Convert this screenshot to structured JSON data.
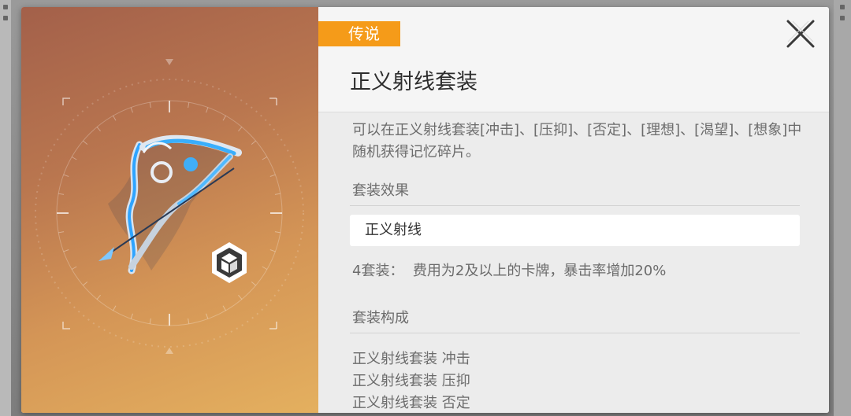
{
  "dialog": {
    "rarity": "传说",
    "title": "正义射线套装",
    "description": "可以在正义射线套装[冲击]、[压抑]、[否定]、[理想]、[渴望]、[想象]中随机获得记忆碎片。",
    "close_icon": "close-x-icon",
    "item_icon": "bow-weapon-image",
    "type_badge_icon": "cube-icon"
  },
  "set_effect": {
    "heading": "套装效果",
    "name": "正义射线",
    "bonus_label": "4套装：",
    "bonus_text": "费用为2及以上的卡牌，暴击率增加20%"
  },
  "set_composition": {
    "heading": "套装构成",
    "pieces": [
      "正义射线套装 冲击",
      "正义射线套装 压抑",
      "正义射线套装 否定"
    ]
  },
  "colors": {
    "rarity": "#f59b19",
    "panel": "#f1f1f1",
    "text": "#6c6c6c",
    "title": "#2d2d2d"
  }
}
